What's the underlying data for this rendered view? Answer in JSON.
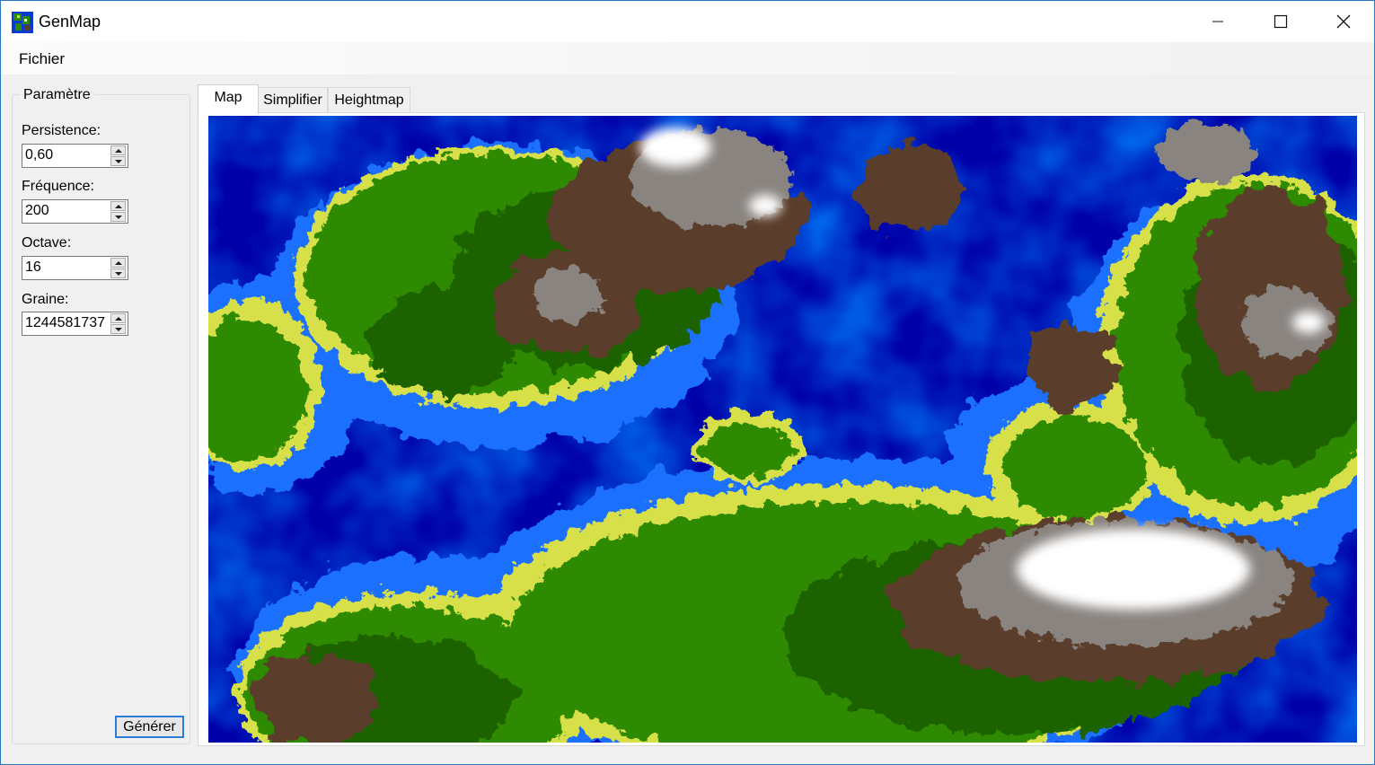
{
  "window": {
    "title": "GenMap",
    "controls": {
      "minimize_icon": "minimize-icon",
      "maximize_icon": "maximize-icon",
      "close_icon": "close-icon"
    }
  },
  "menu": {
    "items": [
      "Fichier"
    ]
  },
  "params": {
    "group_title": "Paramètre",
    "fields": [
      {
        "label": "Persistence:",
        "value": "0,60"
      },
      {
        "label": "Fréquence:",
        "value": "200"
      },
      {
        "label": "Octave:",
        "value": "16"
      },
      {
        "label": "Graine:",
        "value": "1244581737"
      }
    ],
    "generate_label": "Générer"
  },
  "tabs": [
    {
      "label": "Map",
      "active": true
    },
    {
      "label": "Simplifier",
      "active": false
    },
    {
      "label": "Heightmap",
      "active": false
    }
  ],
  "map": {
    "palette": {
      "deep_water": "#0000a8",
      "water": "#0033dd",
      "shallow_water": "#1e6fff",
      "sand": "#d8e04a",
      "grass": "#2d8a00",
      "dark_grass": "#1f6400",
      "mountain": "#5a3d2b",
      "rock": "#8a8480",
      "snow": "#ffffff"
    }
  }
}
